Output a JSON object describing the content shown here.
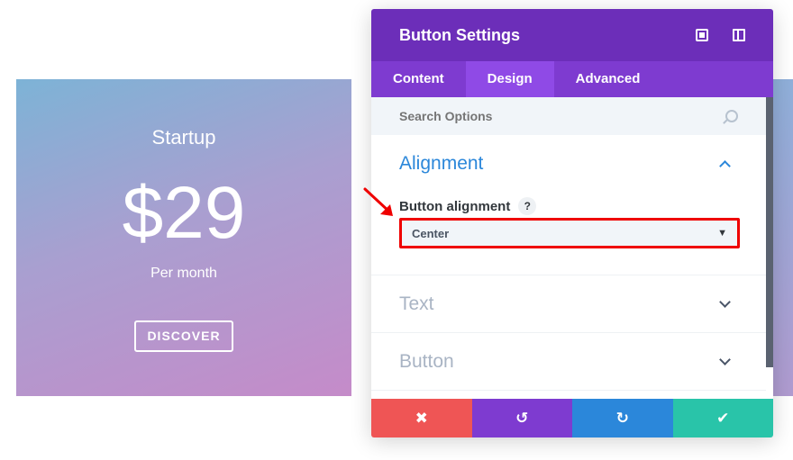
{
  "pricing_card": {
    "title": "Startup",
    "price": "$29",
    "period": "Per month",
    "button_label": "DISCOVER"
  },
  "modal": {
    "title": "Button Settings",
    "header_icons": [
      "fullscreen-icon",
      "split-view-icon"
    ],
    "tabs": [
      {
        "label": "Content",
        "active": false
      },
      {
        "label": "Design",
        "active": true
      },
      {
        "label": "Advanced",
        "active": false
      }
    ],
    "search": {
      "placeholder": "Search Options"
    },
    "sections": [
      {
        "title": "Alignment",
        "open": true
      },
      {
        "title": "Text",
        "open": false
      },
      {
        "title": "Button",
        "open": false
      }
    ],
    "alignment": {
      "field_label": "Button alignment",
      "help": "?",
      "selected": "Center"
    },
    "footer": {
      "cancel_icon": "✖",
      "undo_icon": "↺",
      "redo_icon": "↻",
      "save_icon": "✔"
    }
  },
  "colors": {
    "header": "#6c2eb9",
    "tabs": "#7e3bd0",
    "accent_blue": "#2b87da",
    "highlight_red": "#ef0000",
    "cancel": "#ef5555",
    "save": "#29c4a9"
  }
}
